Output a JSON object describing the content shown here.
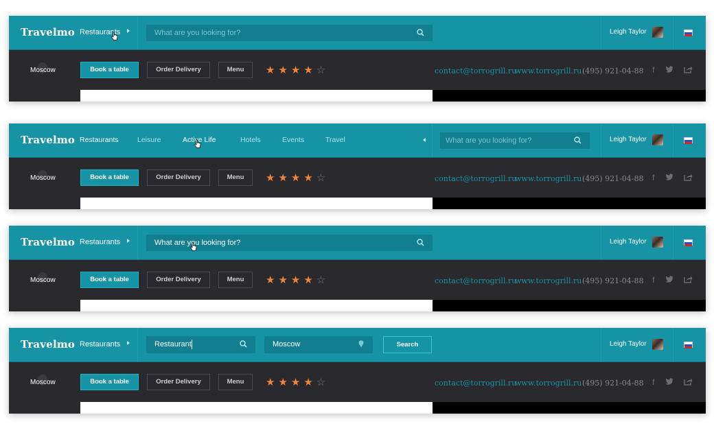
{
  "brand": {
    "logo": "Travelmo",
    "accent": "#1693a5",
    "dark": "#2a292d",
    "star_color": "#f0853a"
  },
  "nav": {
    "restaurants": "Restaurants",
    "items": [
      "Restaurants",
      "Leisure",
      "Active Life",
      "Hotels",
      "Events",
      "Travel"
    ],
    "active": "Active Life"
  },
  "search": {
    "placeholder": "What are you looking for?",
    "query_value": "Restaurant",
    "location_value": "Moscow",
    "button": "Search"
  },
  "user": {
    "name": "Leigh Taylor",
    "avatar_icon": "avatar",
    "language_flag": "russia-flag-icon"
  },
  "venue": {
    "city": "Moscow",
    "book": "Book a table",
    "delivery": "Order Delivery",
    "menu": "Menu",
    "rating": 4,
    "rating_max": 5,
    "email": "contact@torrogrill.ru",
    "website": "www.torrogrill.ru",
    "phone": "(495) 921-04-88",
    "separator": "·",
    "social_icons": [
      "facebook-icon",
      "twitter-icon",
      "share-icon"
    ]
  }
}
